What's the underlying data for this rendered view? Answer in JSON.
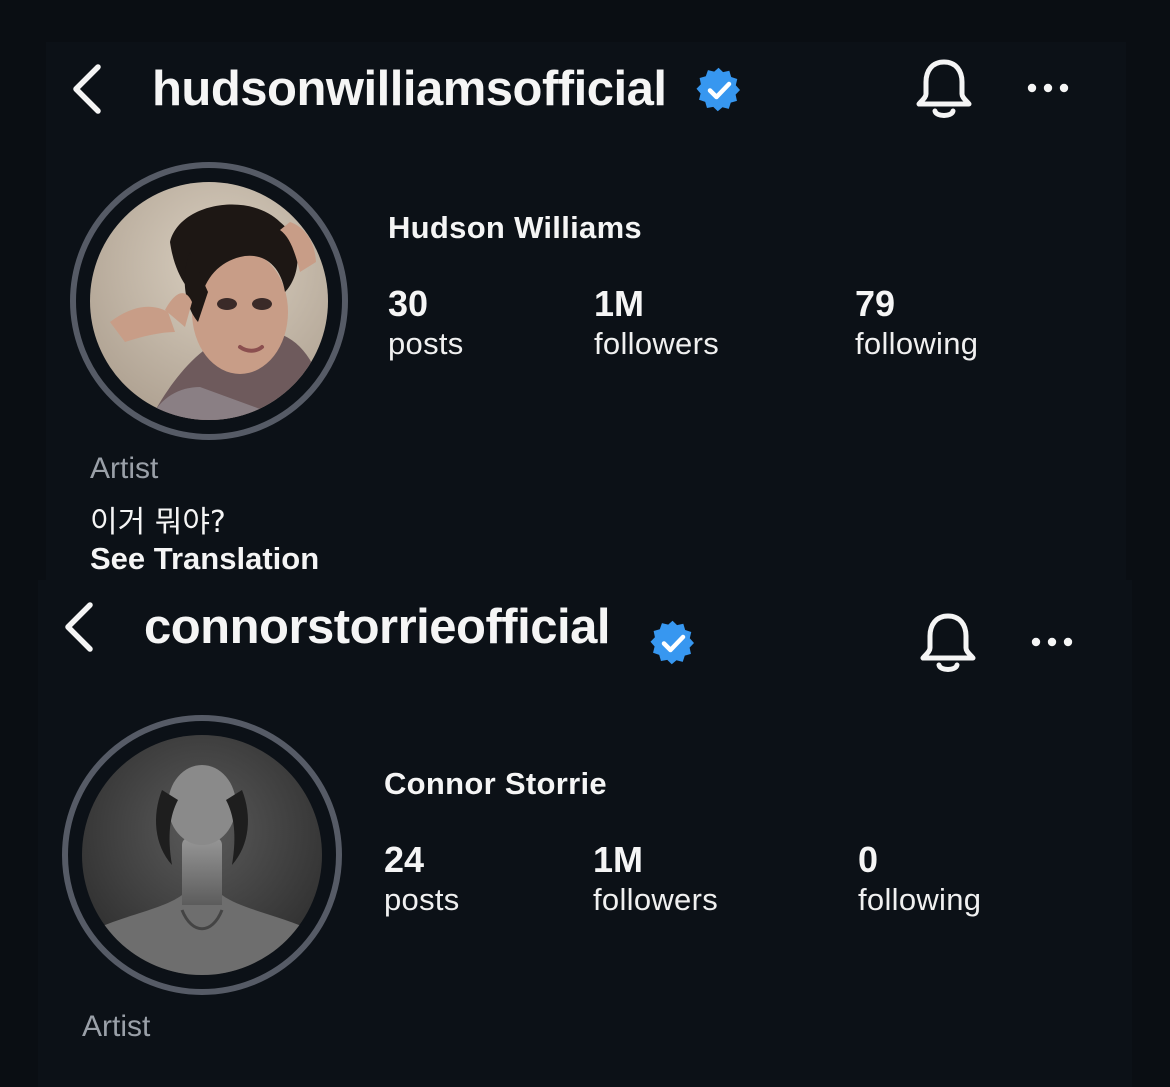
{
  "profiles": [
    {
      "username": "hudsonwilliamsofficial",
      "verified": true,
      "full_name": "Hudson Williams",
      "stats": [
        {
          "value": "30",
          "label": "posts"
        },
        {
          "value": "1M",
          "label": "followers"
        },
        {
          "value": "79",
          "label": "following"
        }
      ],
      "category": "Artist",
      "bio": "이거 뭐야?",
      "see_translation": "See Translation",
      "icons": {
        "back": "chevron-left-icon",
        "verified": "verified-badge-icon",
        "bell": "bell-icon",
        "more": "more-horizontal-icon"
      }
    },
    {
      "username": "connorstorrieofficial",
      "verified": true,
      "full_name": "Connor Storrie",
      "stats": [
        {
          "value": "24",
          "label": "posts"
        },
        {
          "value": "1M",
          "label": "followers"
        },
        {
          "value": "0",
          "label": "following"
        }
      ],
      "category": "Artist",
      "icons": {
        "back": "chevron-left-icon",
        "verified": "verified-badge-icon",
        "bell": "bell-icon",
        "more": "more-horizontal-icon"
      }
    }
  ],
  "colors": {
    "background": "#0a0e13",
    "panel": "#0c1117",
    "text": "#f5f5f5",
    "muted": "#9aa0a8",
    "verified_blue": "#3797f0",
    "avatar_ring": "#565b66"
  }
}
